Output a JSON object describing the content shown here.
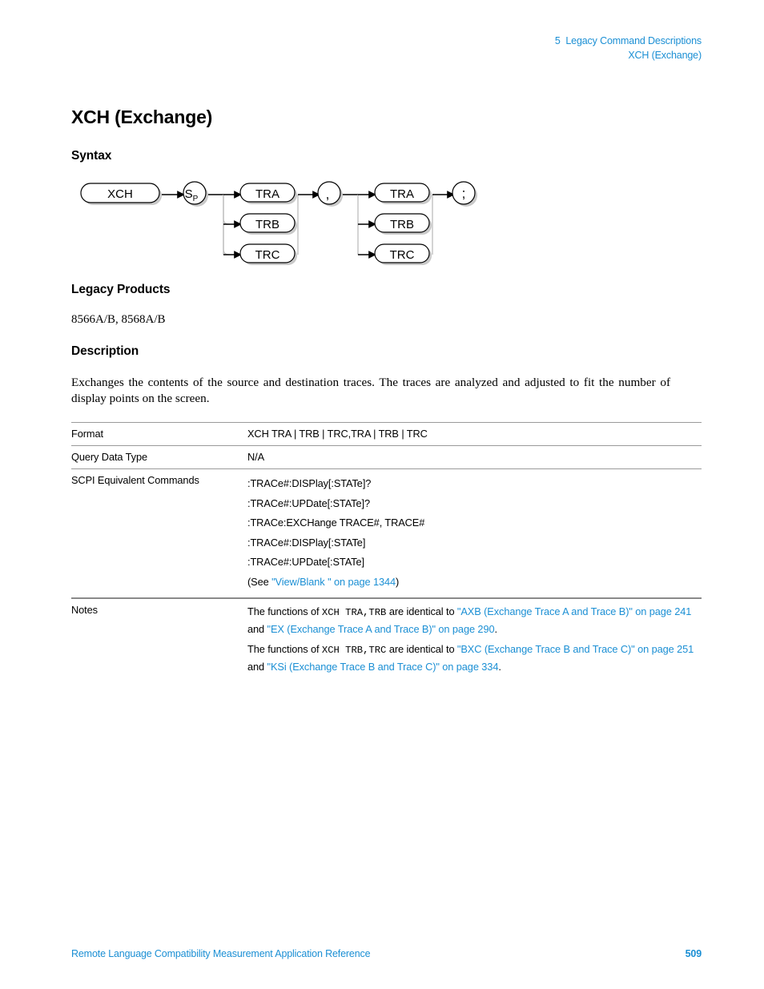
{
  "header": {
    "chapter_line": "5  Legacy Command Descriptions",
    "topic_line": "XCH (Exchange)"
  },
  "title": "XCH (Exchange)",
  "sections": {
    "syntax_heading": "Syntax",
    "legacy_heading": "Legacy Products",
    "legacy_products": "8566A/B, 8568A/B",
    "description_heading": "Description",
    "description_text": "Exchanges the contents of the source and destination traces. The traces are analyzed and adjusted to fit the number of display points on the screen."
  },
  "syntax_diagram": {
    "nodes": {
      "command": "XCH",
      "space": "S",
      "space_sub": "P",
      "first_trace_options": [
        "TRA",
        "TRB",
        "TRC"
      ],
      "separator": ",",
      "second_trace_options": [
        "TRA",
        "TRB",
        "TRC"
      ],
      "terminator": ";"
    }
  },
  "table": {
    "rows": [
      {
        "label": "Format",
        "value": "XCH TRA | TRB | TRC,TRA | TRB | TRC"
      },
      {
        "label": "Query Data Type",
        "value": "N/A"
      }
    ],
    "scpi": {
      "label": "SCPI Equivalent Commands",
      "commands": [
        ":TRACe#:DISPlay[:STATe]?",
        ":TRACe#:UPDate[:STATe]?",
        ":TRACe:EXCHange TRACE#, TRACE#",
        ":TRACe#:DISPlay[:STATe]",
        ":TRACe#:UPDate[:STATe]"
      ],
      "see_prefix": "(See ",
      "see_link": "\"View/Blank \" on page 1344",
      "see_suffix": ")"
    },
    "notes": {
      "label": "Notes",
      "paragraph1": {
        "text_before": "The functions of ",
        "mono": "XCH  TRA,TRB",
        "text_middle": " are identical to ",
        "link1": "\"AXB (Exchange Trace A and Trace B)\" on page 241",
        "text_and": " and ",
        "link2": "\"EX (Exchange Trace A and Trace B)\" on page 290",
        "text_end": "."
      },
      "paragraph2": {
        "text_before": "The functions of ",
        "mono": "XCH  TRB,TRC",
        "text_middle": " are identical to ",
        "link1": "\"BXC (Exchange Trace B and Trace C)\" on page 251",
        "text_and": " and ",
        "link2": "\"KSi (Exchange Trace B and Trace C)\" on page 334",
        "text_end": "."
      }
    }
  },
  "footer": {
    "title": "Remote Language Compatibility Measurement Application Reference",
    "page_number": "509"
  },
  "colors": {
    "link_blue": "#1b8fd4",
    "rule_gray": "#9a9a9a",
    "text_black": "#000000"
  }
}
